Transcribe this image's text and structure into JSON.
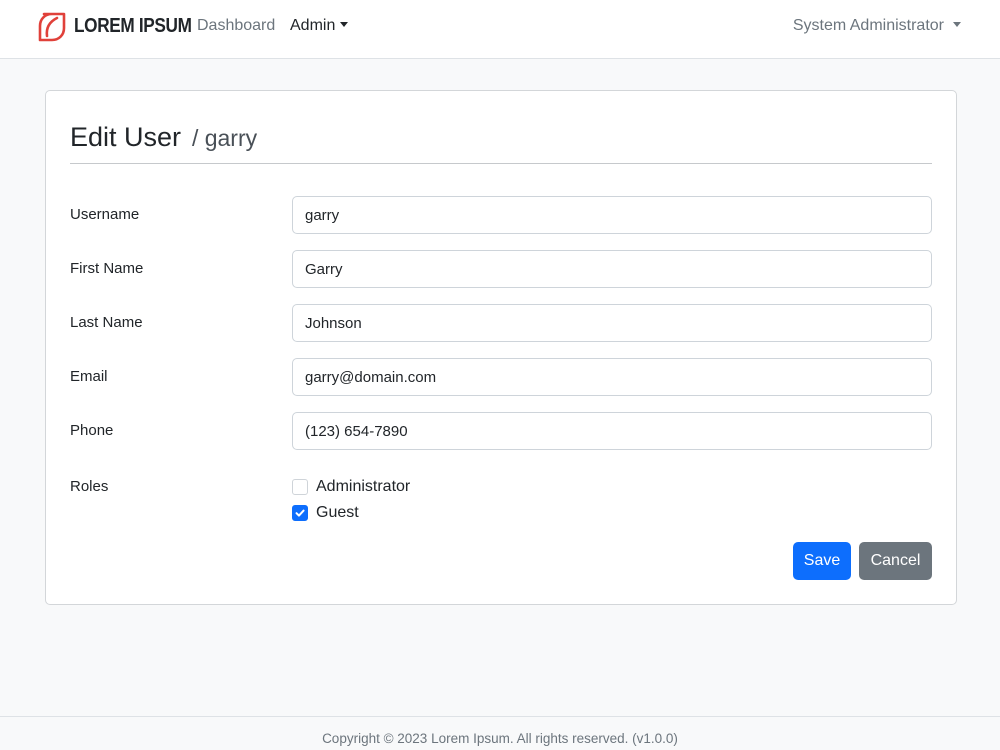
{
  "navbar": {
    "brand_name": "LOREM IPSUM",
    "links": {
      "dashboard": "Dashboard",
      "admin": "Admin"
    },
    "user_menu": "System Administrator"
  },
  "form": {
    "title": "Edit User",
    "subtitle": "/ garry",
    "fields": {
      "username": {
        "label": "Username",
        "value": "garry"
      },
      "first_name": {
        "label": "First Name",
        "value": "Garry"
      },
      "last_name": {
        "label": "Last Name",
        "value": "Johnson"
      },
      "email": {
        "label": "Email",
        "value": "garry@domain.com"
      },
      "phone": {
        "label": "Phone",
        "value": "(123) 654-7890"
      }
    },
    "roles": {
      "label": "Roles",
      "options": [
        {
          "label": "Administrator",
          "checked": false
        },
        {
          "label": "Guest",
          "checked": true
        }
      ]
    },
    "save_label": "Save",
    "cancel_label": "Cancel"
  },
  "footer": {
    "text": "Copyright © 2023 Lorem Ipsum. All rights reserved. (v1.0.0)"
  },
  "colors": {
    "primary": "#0d6efd",
    "secondary": "#6c757d",
    "logo": "#e0413a",
    "page_background": "#f8f9fa"
  }
}
